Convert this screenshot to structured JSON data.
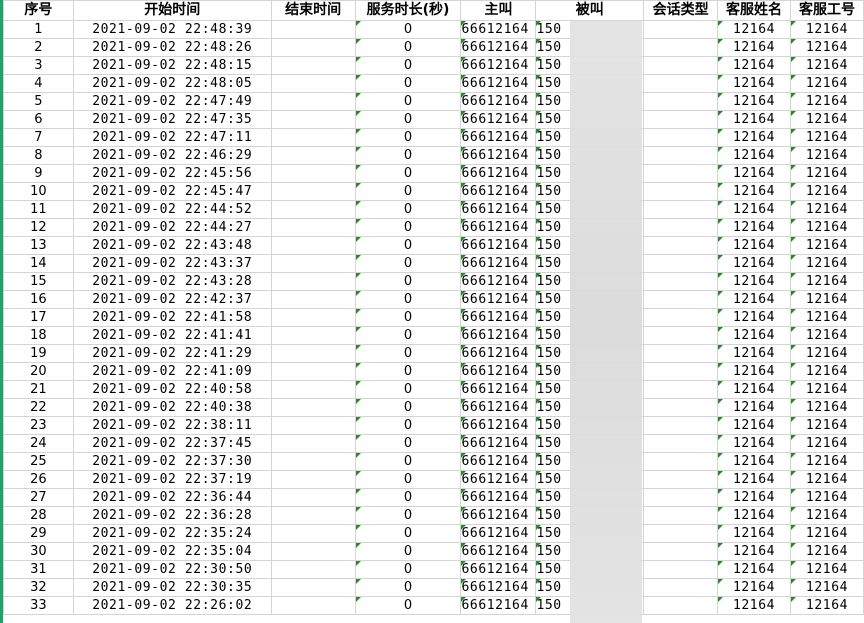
{
  "headers": {
    "seq": "序号",
    "start": "开始时间",
    "end": "结束时间",
    "duration": "服务时长(秒)",
    "caller": "主叫",
    "callee": "被叫",
    "session_type": "会话类型",
    "agent_name": "客服姓名",
    "agent_id": "客服工号"
  },
  "rows": [
    {
      "seq": "1",
      "start": "2021-09-02 22:48:39",
      "duration": "0",
      "caller": "66612164",
      "callee": "150",
      "agent_name": "12164",
      "agent_id": "12164"
    },
    {
      "seq": "2",
      "start": "2021-09-02 22:48:26",
      "duration": "0",
      "caller": "66612164",
      "callee": "150",
      "agent_name": "12164",
      "agent_id": "12164"
    },
    {
      "seq": "3",
      "start": "2021-09-02 22:48:15",
      "duration": "0",
      "caller": "66612164",
      "callee": "150",
      "agent_name": "12164",
      "agent_id": "12164"
    },
    {
      "seq": "4",
      "start": "2021-09-02 22:48:05",
      "duration": "0",
      "caller": "66612164",
      "callee": "150",
      "agent_name": "12164",
      "agent_id": "12164"
    },
    {
      "seq": "5",
      "start": "2021-09-02 22:47:49",
      "duration": "0",
      "caller": "66612164",
      "callee": "150",
      "agent_name": "12164",
      "agent_id": "12164"
    },
    {
      "seq": "6",
      "start": "2021-09-02 22:47:35",
      "duration": "0",
      "caller": "66612164",
      "callee": "150",
      "agent_name": "12164",
      "agent_id": "12164"
    },
    {
      "seq": "7",
      "start": "2021-09-02 22:47:11",
      "duration": "0",
      "caller": "66612164",
      "callee": "150",
      "agent_name": "12164",
      "agent_id": "12164"
    },
    {
      "seq": "8",
      "start": "2021-09-02 22:46:29",
      "duration": "0",
      "caller": "66612164",
      "callee": "150",
      "agent_name": "12164",
      "agent_id": "12164"
    },
    {
      "seq": "9",
      "start": "2021-09-02 22:45:56",
      "duration": "0",
      "caller": "66612164",
      "callee": "150",
      "agent_name": "12164",
      "agent_id": "12164"
    },
    {
      "seq": "10",
      "start": "2021-09-02 22:45:47",
      "duration": "0",
      "caller": "66612164",
      "callee": "150",
      "agent_name": "12164",
      "agent_id": "12164"
    },
    {
      "seq": "11",
      "start": "2021-09-02 22:44:52",
      "duration": "0",
      "caller": "66612164",
      "callee": "150",
      "agent_name": "12164",
      "agent_id": "12164"
    },
    {
      "seq": "12",
      "start": "2021-09-02 22:44:27",
      "duration": "0",
      "caller": "66612164",
      "callee": "150",
      "agent_name": "12164",
      "agent_id": "12164"
    },
    {
      "seq": "13",
      "start": "2021-09-02 22:43:48",
      "duration": "0",
      "caller": "66612164",
      "callee": "150",
      "agent_name": "12164",
      "agent_id": "12164"
    },
    {
      "seq": "14",
      "start": "2021-09-02 22:43:37",
      "duration": "0",
      "caller": "66612164",
      "callee": "150",
      "agent_name": "12164",
      "agent_id": "12164"
    },
    {
      "seq": "15",
      "start": "2021-09-02 22:43:28",
      "duration": "0",
      "caller": "66612164",
      "callee": "150",
      "agent_name": "12164",
      "agent_id": "12164"
    },
    {
      "seq": "16",
      "start": "2021-09-02 22:42:37",
      "duration": "0",
      "caller": "66612164",
      "callee": "150",
      "agent_name": "12164",
      "agent_id": "12164"
    },
    {
      "seq": "17",
      "start": "2021-09-02 22:41:58",
      "duration": "0",
      "caller": "66612164",
      "callee": "150",
      "agent_name": "12164",
      "agent_id": "12164"
    },
    {
      "seq": "18",
      "start": "2021-09-02 22:41:41",
      "duration": "0",
      "caller": "66612164",
      "callee": "150",
      "agent_name": "12164",
      "agent_id": "12164"
    },
    {
      "seq": "19",
      "start": "2021-09-02 22:41:29",
      "duration": "0",
      "caller": "66612164",
      "callee": "150",
      "agent_name": "12164",
      "agent_id": "12164"
    },
    {
      "seq": "20",
      "start": "2021-09-02 22:41:09",
      "duration": "0",
      "caller": "66612164",
      "callee": "150",
      "agent_name": "12164",
      "agent_id": "12164"
    },
    {
      "seq": "21",
      "start": "2021-09-02 22:40:58",
      "duration": "0",
      "caller": "66612164",
      "callee": "150",
      "agent_name": "12164",
      "agent_id": "12164"
    },
    {
      "seq": "22",
      "start": "2021-09-02 22:40:38",
      "duration": "0",
      "caller": "66612164",
      "callee": "150",
      "agent_name": "12164",
      "agent_id": "12164"
    },
    {
      "seq": "23",
      "start": "2021-09-02 22:38:11",
      "duration": "0",
      "caller": "66612164",
      "callee": "150",
      "agent_name": "12164",
      "agent_id": "12164"
    },
    {
      "seq": "24",
      "start": "2021-09-02 22:37:45",
      "duration": "0",
      "caller": "66612164",
      "callee": "150",
      "agent_name": "12164",
      "agent_id": "12164"
    },
    {
      "seq": "25",
      "start": "2021-09-02 22:37:30",
      "duration": "0",
      "caller": "66612164",
      "callee": "150",
      "agent_name": "12164",
      "agent_id": "12164"
    },
    {
      "seq": "26",
      "start": "2021-09-02 22:37:19",
      "duration": "0",
      "caller": "66612164",
      "callee": "150",
      "agent_name": "12164",
      "agent_id": "12164"
    },
    {
      "seq": "27",
      "start": "2021-09-02 22:36:44",
      "duration": "0",
      "caller": "66612164",
      "callee": "150",
      "agent_name": "12164",
      "agent_id": "12164"
    },
    {
      "seq": "28",
      "start": "2021-09-02 22:36:28",
      "duration": "0",
      "caller": "66612164",
      "callee": "150",
      "agent_name": "12164",
      "agent_id": "12164"
    },
    {
      "seq": "29",
      "start": "2021-09-02 22:35:24",
      "duration": "0",
      "caller": "66612164",
      "callee": "150",
      "agent_name": "12164",
      "agent_id": "12164"
    },
    {
      "seq": "30",
      "start": "2021-09-02 22:35:04",
      "duration": "0",
      "caller": "66612164",
      "callee": "150",
      "agent_name": "12164",
      "agent_id": "12164"
    },
    {
      "seq": "31",
      "start": "2021-09-02 22:30:50",
      "duration": "0",
      "caller": "66612164",
      "callee": "150",
      "agent_name": "12164",
      "agent_id": "12164"
    },
    {
      "seq": "32",
      "start": "2021-09-02 22:30:35",
      "duration": "0",
      "caller": "66612164",
      "callee": "150",
      "agent_name": "12164",
      "agent_id": "12164"
    },
    {
      "seq": "33",
      "start": "2021-09-02 22:26:02",
      "duration": "0",
      "caller": "66612164",
      "callee": "150",
      "agent_name": "12164",
      "agent_id": "12164"
    }
  ],
  "colors": {
    "gridline": "#d4d4d4",
    "error_triangle": "#2a8a2a",
    "accent": "#21a366"
  }
}
